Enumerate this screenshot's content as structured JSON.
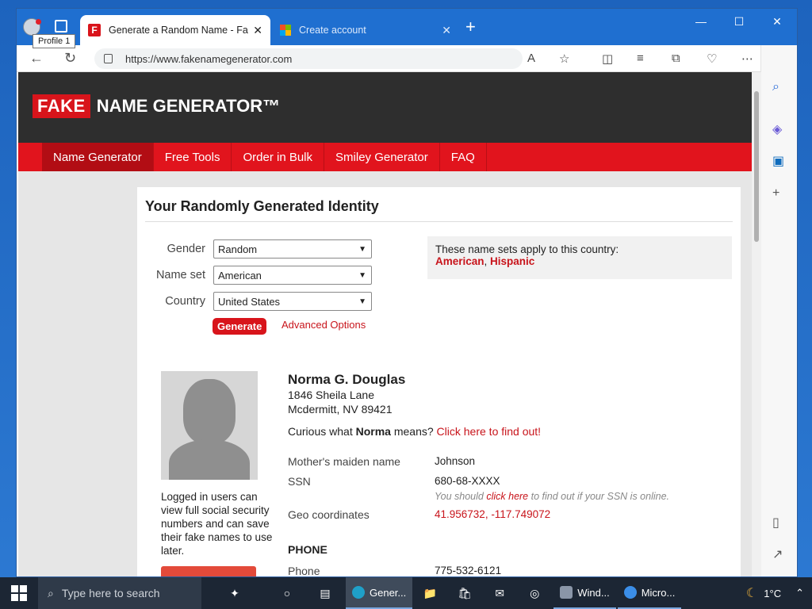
{
  "browser": {
    "profile_tooltip": "Profile 1",
    "tabs": [
      {
        "title": "Generate a Random Name - Fake",
        "active": true
      },
      {
        "title": "Create account",
        "active": false
      }
    ],
    "url": "https://www.fakenamegenerator.com"
  },
  "site": {
    "logo_fake": "FAKE",
    "logo_rest": "NAME GENERATOR™",
    "nav": [
      "Name Generator",
      "Free Tools",
      "Order in Bulk",
      "Smiley Generator",
      "FAQ"
    ]
  },
  "card": {
    "title": "Your Randomly Generated Identity",
    "form": {
      "gender_label": "Gender",
      "gender_value": "Random",
      "nameset_label": "Name set",
      "nameset_value": "American",
      "country_label": "Country",
      "country_value": "United States",
      "generate_label": "Generate",
      "advanced_label": "Advanced Options"
    },
    "nameset_box": {
      "text": "These name sets apply to this country:",
      "link1": "American",
      "sep": ", ",
      "link2": "Hispanic"
    },
    "logged_note": "Logged in users can view full social security numbers and can save their fake names to use later.",
    "identity": {
      "name": "Norma G. Douglas",
      "address1": "1846 Sheila Lane",
      "address2": "Mcdermitt, NV 89421",
      "curious_pre": "Curious what ",
      "curious_name": "Norma",
      "curious_mid": " means? ",
      "curious_link": "Click here to find out!",
      "maiden_label": "Mother's maiden name",
      "maiden_value": "Johnson",
      "ssn_label": "SSN",
      "ssn_value": "680-68-XXXX",
      "ssn_note_pre": "You should ",
      "ssn_note_link": "click here",
      "ssn_note_post": " to find out if your SSN is online.",
      "geo_label": "Geo coordinates",
      "geo_value": "41.956732, -117.749072",
      "phone_section": "PHONE",
      "phone_label": "Phone",
      "phone_value": "775-532-6121"
    }
  },
  "taskbar": {
    "search_placeholder": "Type here to search",
    "apps": [
      "Gener...",
      "Wind...",
      "Micro..."
    ],
    "weather": "1°C"
  }
}
